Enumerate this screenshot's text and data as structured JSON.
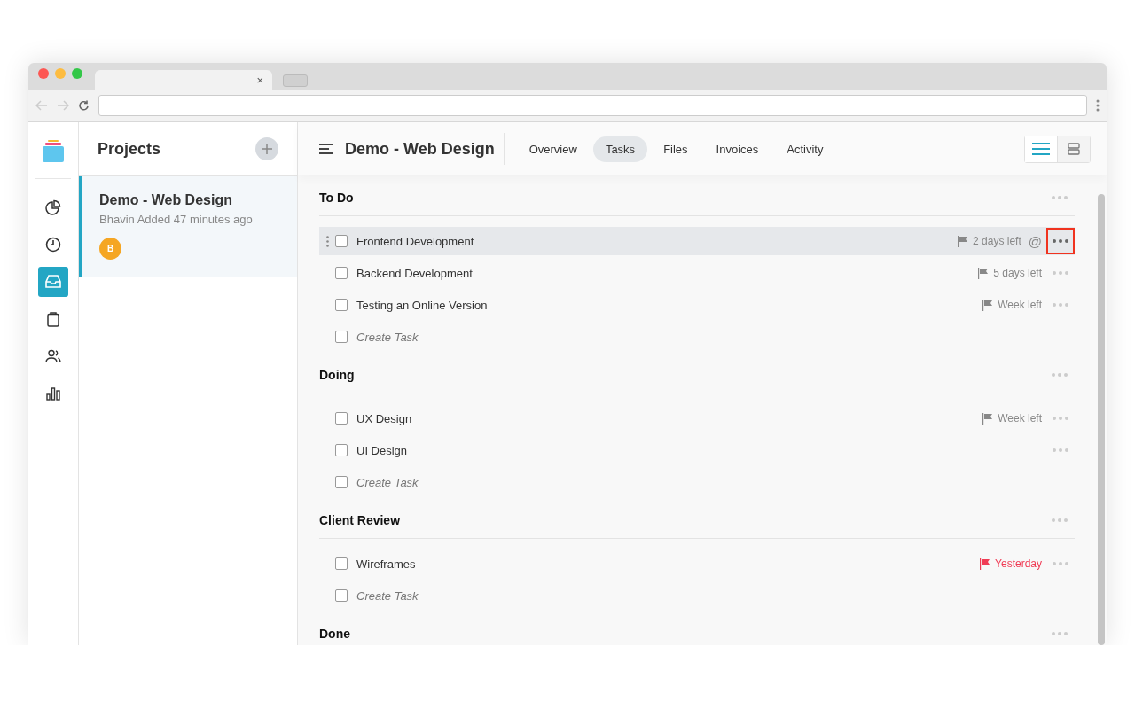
{
  "browser": {
    "tab_close": "×"
  },
  "rail": {
    "items": [
      {
        "selected": false
      },
      {
        "selected": false
      },
      {
        "selected": true
      },
      {
        "selected": false
      },
      {
        "selected": false
      },
      {
        "selected": false
      }
    ]
  },
  "projects": {
    "title": "Projects",
    "items": [
      {
        "name": "Demo - Web Design",
        "meta": "Bhavin Added 47 minutes ago",
        "avatar": "B",
        "selected": true
      }
    ]
  },
  "header": {
    "title": "Demo - Web Design",
    "tabs": [
      {
        "label": "Overview",
        "selected": false
      },
      {
        "label": "Tasks",
        "selected": true
      },
      {
        "label": "Files",
        "selected": false
      },
      {
        "label": "Invoices",
        "selected": false
      },
      {
        "label": "Activity",
        "selected": false
      }
    ],
    "views": [
      {
        "selected": true
      },
      {
        "selected": false
      }
    ]
  },
  "sections": [
    {
      "title": "To Do",
      "tasks": [
        {
          "kind": "task",
          "name": "Frontend Development",
          "checked": false,
          "selected": true,
          "due": "2 days left",
          "overdue": false,
          "mention": "@"
        },
        {
          "kind": "task",
          "name": "Backend Development",
          "checked": false,
          "selected": false,
          "due": "5 days left",
          "overdue": false
        },
        {
          "kind": "task",
          "name": "Testing an Online Version",
          "checked": false,
          "selected": false,
          "due": "Week left",
          "overdue": false
        },
        {
          "kind": "create",
          "name": "Create Task",
          "checked": false
        }
      ]
    },
    {
      "title": "Doing",
      "tasks": [
        {
          "kind": "task",
          "name": "UX Design",
          "checked": false,
          "selected": false,
          "due": "Week left",
          "overdue": false
        },
        {
          "kind": "task",
          "name": "UI Design",
          "checked": false,
          "selected": false
        },
        {
          "kind": "create",
          "name": "Create Task",
          "checked": false
        }
      ]
    },
    {
      "title": "Client Review",
      "tasks": [
        {
          "kind": "task",
          "name": "Wireframes",
          "checked": false,
          "selected": false,
          "due": "Yesterday",
          "overdue": true
        },
        {
          "kind": "create",
          "name": "Create Task",
          "checked": false
        }
      ]
    },
    {
      "title": "Done"
    }
  ]
}
